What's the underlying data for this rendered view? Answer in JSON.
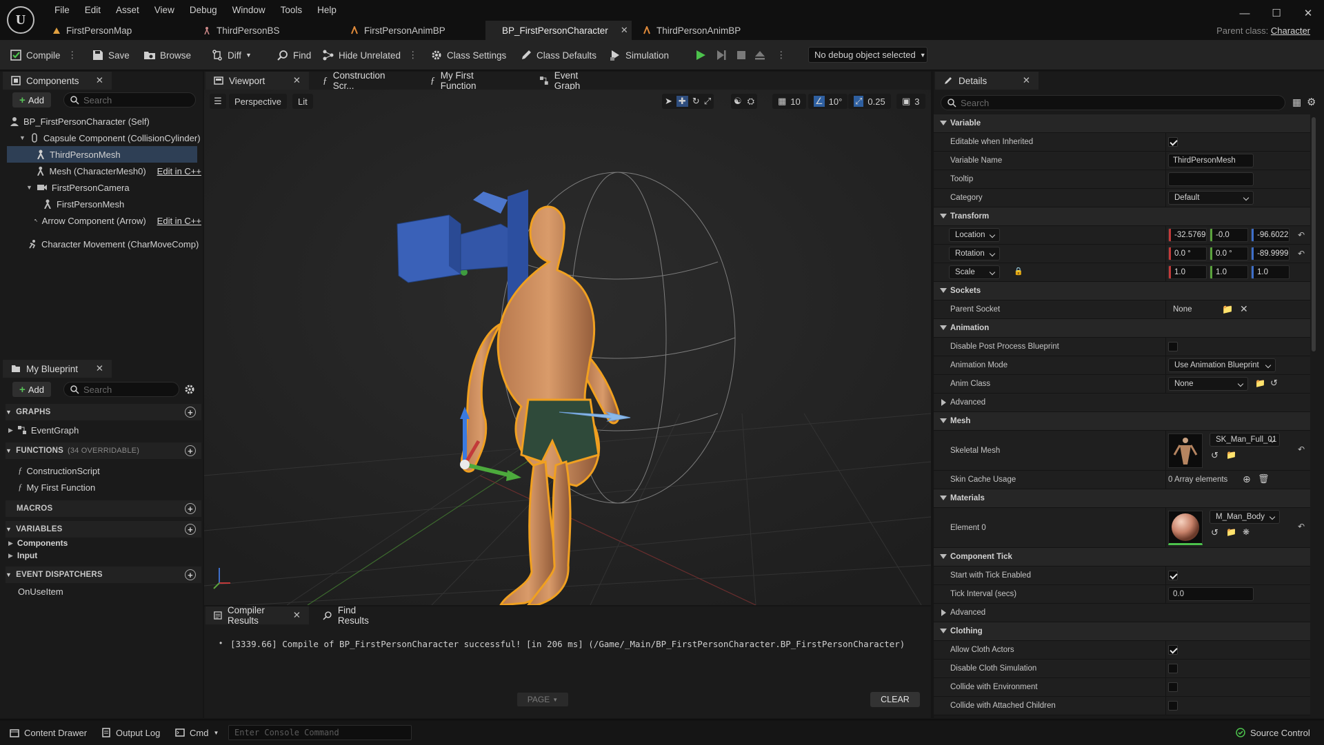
{
  "menu": [
    "File",
    "Edit",
    "Asset",
    "View",
    "Debug",
    "Window",
    "Tools",
    "Help"
  ],
  "doc_tabs": [
    {
      "label": "FirstPersonMap",
      "active": false
    },
    {
      "label": "ThirdPersonBS",
      "active": false
    },
    {
      "label": "FirstPersonAnimBP",
      "active": false
    },
    {
      "label": "BP_FirstPersonCharacter",
      "active": true
    },
    {
      "label": "ThirdPersonAnimBP",
      "active": false
    }
  ],
  "parent_class": {
    "label": "Parent class:",
    "value": "Character"
  },
  "toolbar": {
    "compile": "Compile",
    "save": "Save",
    "browse": "Browse",
    "diff": "Diff",
    "find": "Find",
    "hide_unrelated": "Hide Unrelated",
    "class_settings": "Class Settings",
    "class_defaults": "Class Defaults",
    "simulation": "Simulation",
    "debug_object": "No debug object selected"
  },
  "components_panel": {
    "title": "Components",
    "add": "Add",
    "search_placeholder": "Search",
    "items": [
      {
        "label": "BP_FirstPersonCharacter (Self)",
        "edit": ""
      },
      {
        "label": "Capsule Component (CollisionCylinder)",
        "edit": ""
      },
      {
        "label": "ThirdPersonMesh",
        "edit": ""
      },
      {
        "label": "Mesh (CharacterMesh0)",
        "edit": "Edit in C++"
      },
      {
        "label": "FirstPersonCamera",
        "edit": ""
      },
      {
        "label": "FirstPersonMesh",
        "edit": ""
      },
      {
        "label": "Arrow Component (Arrow)",
        "edit": "Edit in C++"
      },
      {
        "label": "Character Movement (CharMoveComp)",
        "edit": ""
      }
    ]
  },
  "my_blueprint": {
    "title": "My Blueprint",
    "add": "Add",
    "search_placeholder": "Search",
    "graphs": "GRAPHS",
    "event_graph": "EventGraph",
    "functions": "FUNCTIONS",
    "functions_sub": "(34 OVERRIDABLE)",
    "construction_script": "ConstructionScript",
    "my_first_function": "My First Function",
    "macros": "MACROS",
    "variables": "VARIABLES",
    "var_components": "Components",
    "var_input": "Input",
    "event_dispatchers": "EVENT DISPATCHERS",
    "on_use_item": "OnUseItem"
  },
  "graph_tabs": [
    "Viewport",
    "Construction Scr...",
    "My First Function",
    "Event Graph"
  ],
  "viewport": {
    "perspective": "Perspective",
    "lit": "Lit",
    "grid_snap": "10",
    "rot_snap": "10°",
    "scale_snap": "0.25",
    "cam_speed": "3"
  },
  "compiler": {
    "tab1": "Compiler Results",
    "tab2": "Find Results",
    "log": "[3339.66] Compile of BP_FirstPersonCharacter successful! [in 206 ms] (/Game/_Main/BP_FirstPersonCharacter.BP_FirstPersonCharacter)",
    "page": "PAGE",
    "clear": "CLEAR"
  },
  "details": {
    "title": "Details",
    "search_placeholder": "Search",
    "variable": "Variable",
    "editable_inherited": "Editable when Inherited",
    "variable_name_label": "Variable Name",
    "variable_name": "ThirdPersonMesh",
    "tooltip": "Tooltip",
    "category_label": "Category",
    "category": "Default",
    "transform": "Transform",
    "location": "Location",
    "loc_x": "-32.5769",
    "loc_y": "-0.0",
    "loc_z": "-96.6022",
    "rotation": "Rotation",
    "rot_x": "0.0 °",
    "rot_y": "0.0 °",
    "rot_z": "-89.9999",
    "scale": "Scale",
    "scl_x": "1.0",
    "scl_y": "1.0",
    "scl_z": "1.0",
    "sockets": "Sockets",
    "parent_socket": "Parent Socket",
    "parent_socket_value": "None",
    "animation": "Animation",
    "disable_ppb": "Disable Post Process Blueprint",
    "anim_mode_label": "Animation Mode",
    "anim_mode": "Use Animation Blueprint",
    "anim_class_label": "Anim Class",
    "anim_class": "None",
    "advanced": "Advanced",
    "mesh": "Mesh",
    "skeletal_mesh": "Skeletal Mesh",
    "skeletal_mesh_value": "SK_Man_Full_01",
    "skin_cache": "Skin Cache Usage",
    "array_elements": "0 Array elements",
    "materials": "Materials",
    "element0": "Element 0",
    "material_value": "M_Man_Body",
    "component_tick": "Component Tick",
    "start_tick": "Start with Tick Enabled",
    "tick_interval": "Tick Interval (secs)",
    "tick_interval_value": "0.0",
    "advanced2": "Advanced",
    "clothing": "Clothing",
    "allow_cloth": "Allow Cloth Actors",
    "disable_cloth": "Disable Cloth Simulation",
    "collide_env": "Collide with Environment",
    "collide_children": "Collide with Attached Children"
  },
  "status": {
    "content_drawer": "Content Drawer",
    "output_log": "Output Log",
    "cmd": "Cmd",
    "console_placeholder": "Enter Console Command",
    "source_control": "Source Control"
  }
}
